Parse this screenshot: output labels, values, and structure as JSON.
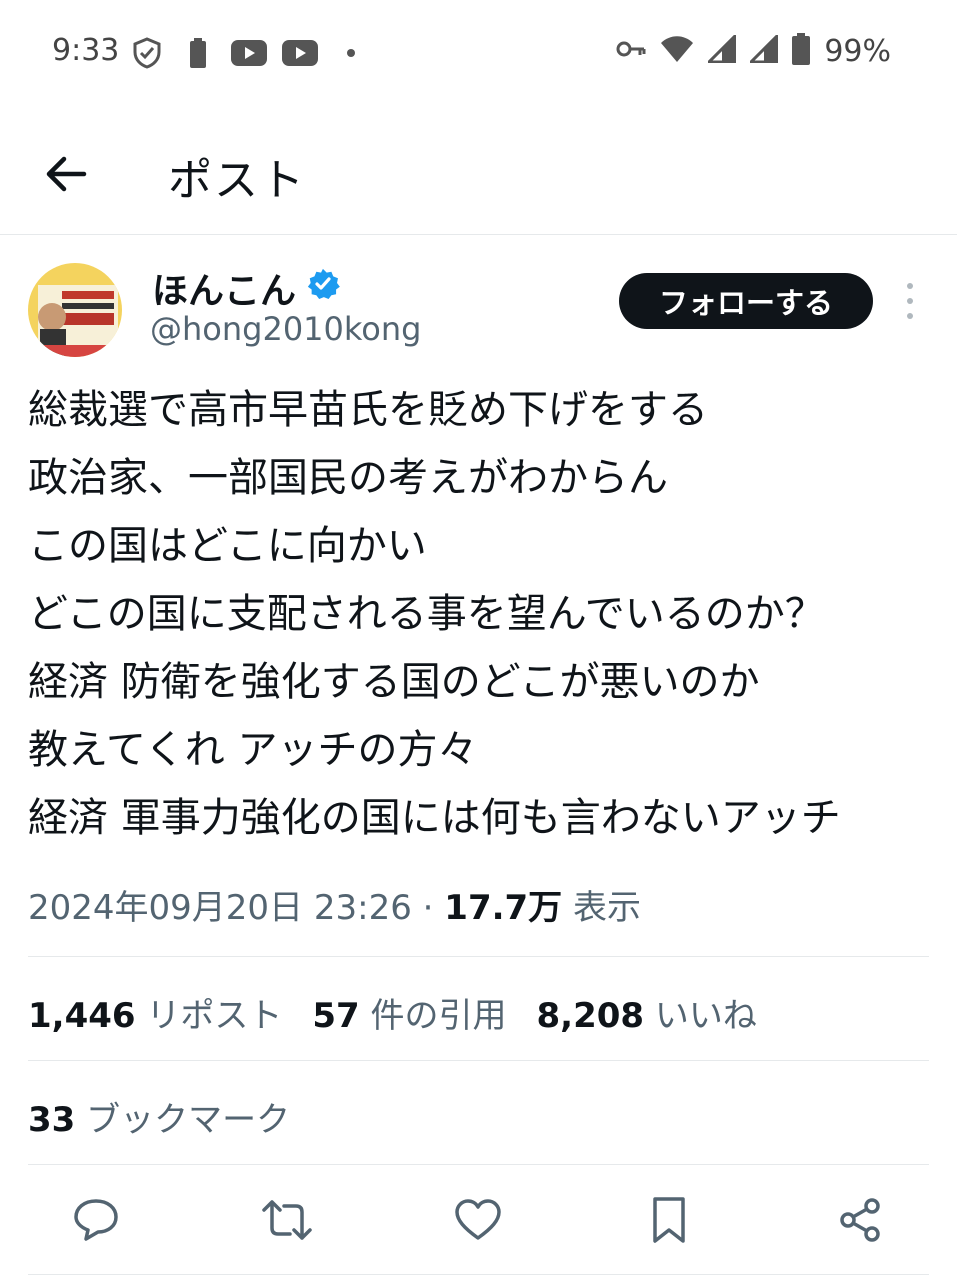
{
  "status_bar": {
    "time": "9:33",
    "battery_pct": "99%",
    "icons_left": [
      "shield-icon",
      "battery-saver-icon",
      "youtube-icon",
      "youtube-icon",
      "dot-icon"
    ],
    "icons_right": [
      "key-icon",
      "wifi-icon",
      "signal-icon",
      "signal-icon",
      "battery-icon"
    ]
  },
  "header": {
    "title": "ポスト"
  },
  "post": {
    "author": {
      "name": "ほんこん",
      "handle": "@hong2010kong",
      "verified": true
    },
    "follow_label": "フォローする",
    "lines": [
      "総裁選で高市早苗氏を貶め下げをする",
      "政治家、一部国民の考えがわからん",
      "この国はどこに向かい",
      "どこの国に支配される事を望んでいるのか？",
      "経済 防衛を強化する国のどこが悪いのか",
      "教えてくれ アッチの方々",
      "経済 軍事力強化の国には何も言わないアッチ"
    ],
    "timestamp": "2024年09月20日 23:26",
    "separator": " · ",
    "views_count": "17.7万",
    "views_label": " 表示"
  },
  "stats": {
    "reposts_count": "1,446",
    "reposts_label": "リポスト",
    "quotes_count": "57",
    "quotes_label": "件の引用",
    "likes_count": "8,208",
    "likes_label": "いいね",
    "bookmarks_count": "33",
    "bookmarks_label": "ブックマーク"
  },
  "colors": {
    "primary_text": "#0f1419",
    "secondary_text": "#536471",
    "verified_blue": "#1d9bf0",
    "divider": "#e6e9eb"
  }
}
